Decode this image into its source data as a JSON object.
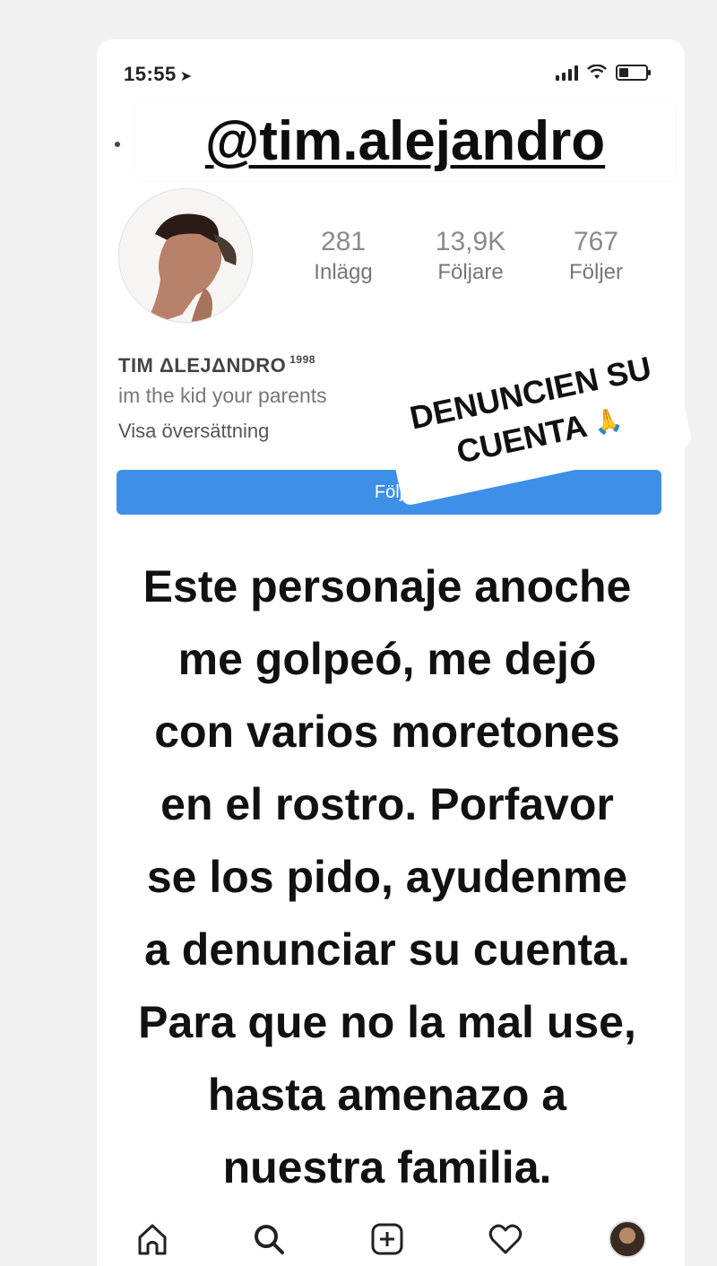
{
  "status_bar": {
    "time": "15:55",
    "location_glyph": "➤"
  },
  "profile": {
    "handle": "@tim.alejandro",
    "stats": [
      {
        "value": "281",
        "label": "Inlägg"
      },
      {
        "value": "13,9K",
        "label": "Följare"
      },
      {
        "value": "767",
        "label": "Följer"
      }
    ],
    "name": "TIM ΔLEJΔNDRO",
    "name_sup": "1998",
    "bio": "im the kid your parents",
    "translate": "Visa översättning",
    "follow_label": "Följ"
  },
  "sticker": {
    "line1": "DENUNCIEN SU",
    "line2": "CUENTA",
    "emoji": "🙏"
  },
  "message": {
    "lines": [
      "Este personaje anoche",
      "me golpeó, me dejó",
      "con varios moretones",
      "en el rostro. Porfavor",
      "se los pido, ayudenme",
      "a denunciar su cuenta.",
      "Para que no la mal use,",
      "hasta amenazo a",
      "nuestra familia."
    ]
  },
  "bottom_nav": {
    "items": [
      "home-icon",
      "search-icon",
      "add-post-icon",
      "heart-icon",
      "profile-avatar"
    ]
  }
}
